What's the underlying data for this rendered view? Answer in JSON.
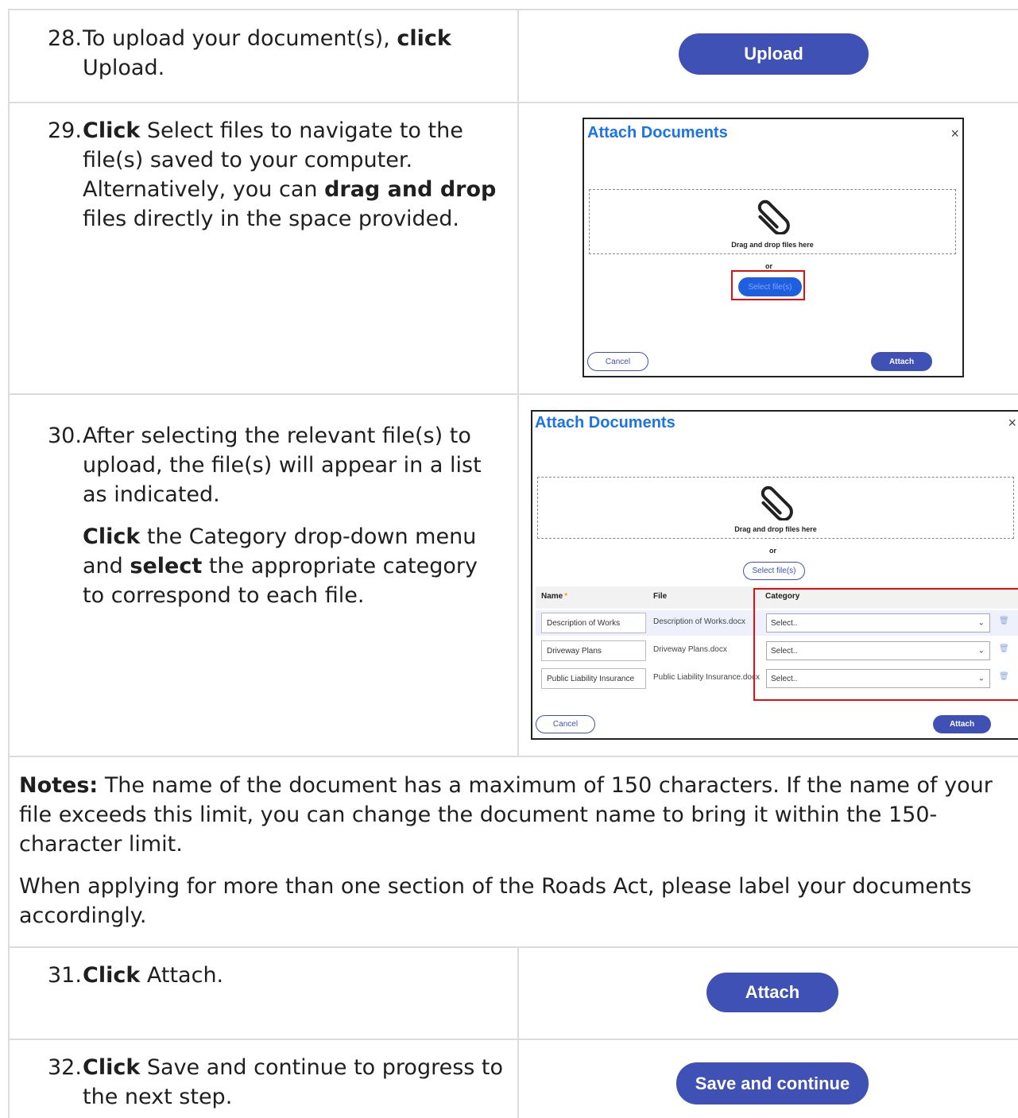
{
  "steps": [
    {
      "num": "28.",
      "parts": [
        "To upload your document(s), ",
        "click",
        " Upload."
      ]
    },
    {
      "num": "29.",
      "parts": [
        "Click",
        " Select files to navigate to the file(s) saved to your computer. Alternatively, you can ",
        "drag and drop",
        " files directly in the space provided."
      ]
    },
    {
      "num": "30.",
      "parts": [
        "After selecting the relevant file(s) to upload, the file(s) will appear in a list as indicated."
      ],
      "para2": [
        "Click",
        " the Category drop-down menu and ",
        "select",
        " the appropriate category to correspond to each file."
      ]
    },
    {
      "num": "31.",
      "parts": [
        "Click",
        " Attach."
      ]
    },
    {
      "num": "32.",
      "parts": [
        "Click",
        " Save and continue to progress to the next step."
      ]
    }
  ],
  "buttons": {
    "upload": "Upload",
    "attach": "Attach",
    "save_continue": "Save and continue"
  },
  "dialog1": {
    "title": "Attach Documents",
    "close": "×",
    "dropzone_text": "Drag and drop files here",
    "or": "or",
    "select_files": "Select file(s)",
    "cancel": "Cancel",
    "attach": "Attach"
  },
  "dialog2": {
    "title": "Attach Documents",
    "close": "×",
    "dropzone_text": "Drag and drop files here",
    "or": "or",
    "select_files": "Select file(s)",
    "headers": {
      "name": "Name",
      "required": "*",
      "file": "File",
      "category": "Category"
    },
    "rows": [
      {
        "name": "Description of Works",
        "file": "Description of Works.docx",
        "category": "Select.."
      },
      {
        "name": "Driveway Plans",
        "file": "Driveway Plans.docx",
        "category": "Select.."
      },
      {
        "name": "Public Liability Insurance",
        "file": "Public Liability Insurance.docx",
        "category": "Select.."
      }
    ],
    "cancel": "Cancel",
    "attach": "Attach"
  },
  "notes": {
    "label": "Notes:",
    "text1": " The name of the document has a maximum of 150 characters.  If the name of your file exceeds this limit, you can change the document name to bring it within the 150-character limit.",
    "text2": "When applying for more than one section of the Roads Act, please label your documents accordingly."
  },
  "colors": {
    "primary": "#3f51b5",
    "title_blue": "#1a73e8",
    "highlight": "#e01010"
  }
}
